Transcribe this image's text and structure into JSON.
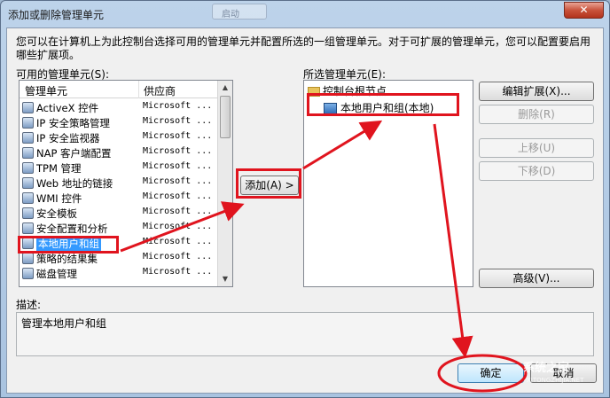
{
  "window": {
    "title": "添加或删除管理单元",
    "background_tab": "启动"
  },
  "intro_text": "您可以在计算机上为此控制台选择可用的管理单元并配置所选的一组管理单元。对于可扩展的管理单元，您可以配置要启用哪些扩展项。",
  "available": {
    "label": "可用的管理单元(S):",
    "columns": [
      "管理单元",
      "供应商"
    ],
    "items": [
      {
        "name": "ActiveX 控件",
        "vendor": "Microsoft ..."
      },
      {
        "name": "IP 安全策略管理",
        "vendor": "Microsoft ..."
      },
      {
        "name": "IP 安全监视器",
        "vendor": "Microsoft ..."
      },
      {
        "name": "NAP 客户端配置",
        "vendor": "Microsoft ..."
      },
      {
        "name": "TPM 管理",
        "vendor": "Microsoft ..."
      },
      {
        "name": "Web 地址的链接",
        "vendor": "Microsoft ..."
      },
      {
        "name": "WMI 控件",
        "vendor": "Microsoft ..."
      },
      {
        "name": "安全模板",
        "vendor": "Microsoft ..."
      },
      {
        "name": "安全配置和分析",
        "vendor": "Microsoft ..."
      },
      {
        "name": "本地用户和组",
        "vendor": "Microsoft ..."
      },
      {
        "name": "策略的结果集",
        "vendor": "Microsoft ..."
      },
      {
        "name": "磁盘管理",
        "vendor": "Microsoft ..."
      }
    ],
    "selected_index": 9
  },
  "add_button": "添加(A) >",
  "selected": {
    "label": "所选管理单元(E):",
    "root": "控制台根节点",
    "child": "本地用户和组(本地)"
  },
  "side_buttons": {
    "edit_extensions": "编辑扩展(X)...",
    "remove": "删除(R)",
    "move_up": "上移(U)",
    "move_down": "下移(D)",
    "advanced": "高级(V)..."
  },
  "description": {
    "label": "描述:",
    "text": "管理本地用户和组"
  },
  "ok_button": "确定",
  "cancel_button": "取消",
  "watermark": {
    "text": "系统之家",
    "sub": "XITONGZHIJIA.NET"
  },
  "colors": {
    "highlight": "#e0141e",
    "selection": "#3399ff"
  }
}
